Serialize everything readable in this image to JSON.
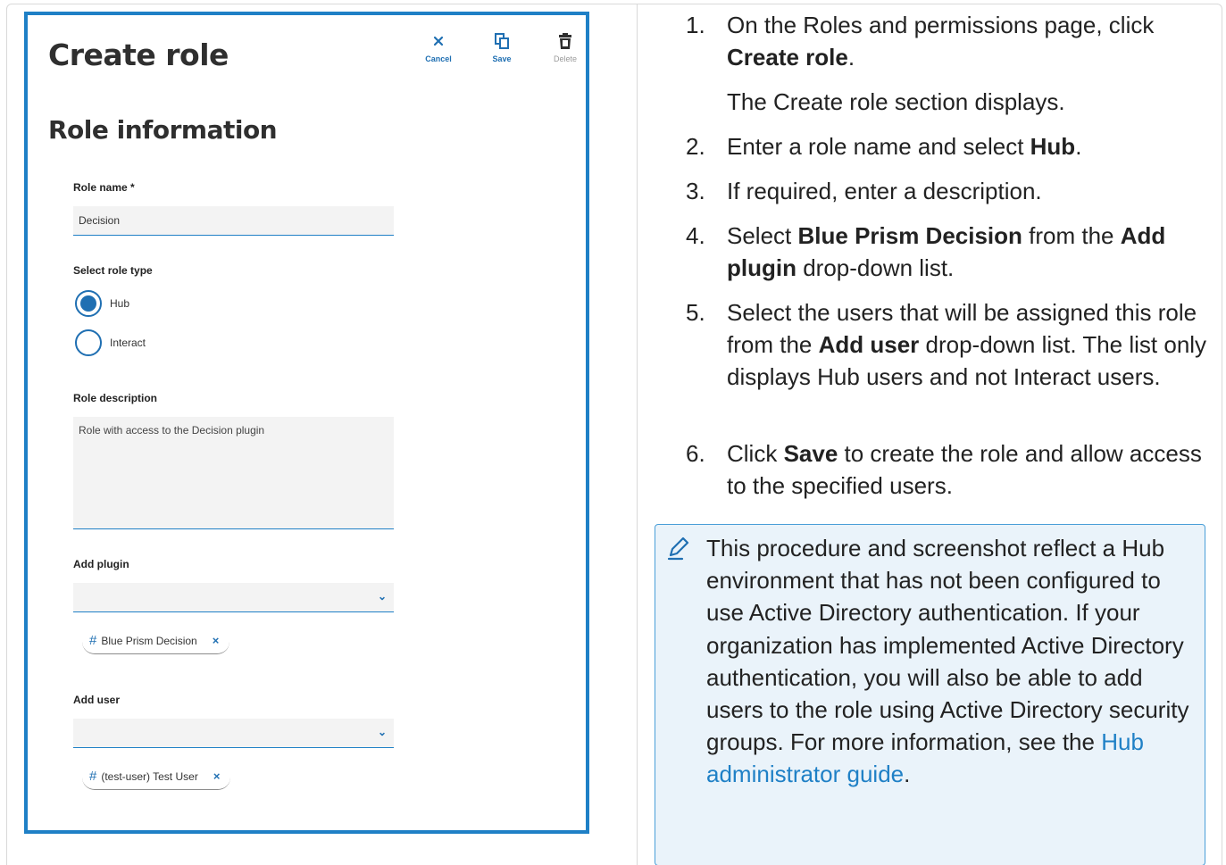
{
  "screenshot": {
    "title": "Create role",
    "toolbar": {
      "cancel": "Cancel",
      "save": "Save",
      "delete": "Delete"
    },
    "section_title": "Role information",
    "role_name": {
      "label": "Role name *",
      "value": "Decision"
    },
    "role_type": {
      "label": "Select role type",
      "options": [
        {
          "label": "Hub",
          "selected": true
        },
        {
          "label": "Interact",
          "selected": false
        }
      ]
    },
    "role_description": {
      "label": "Role description",
      "value": "Role with access to the Decision plugin"
    },
    "add_plugin": {
      "label": "Add plugin",
      "chip": "Blue Prism Decision"
    },
    "add_user": {
      "label": "Add user",
      "chip": "(test-user) Test User"
    }
  },
  "steps": [
    {
      "num": "1.",
      "pre": "On the Roles and permissions page, click ",
      "bold": "Create role",
      "post": ".",
      "sub": "The Create role section displays."
    },
    {
      "num": "2.",
      "pre": "Enter a role name and select ",
      "bold": "Hub",
      "post": "."
    },
    {
      "num": "3.",
      "pre": "If required, enter a description."
    },
    {
      "num": "4.",
      "pre": "Select ",
      "bold": "Blue Prism Decision",
      "mid": " from the ",
      "bold2": "Add plugin",
      "post": " drop-down list."
    },
    {
      "num": "5.",
      "pre": "Select the users that will be assigned this role from the ",
      "bold": "Add user",
      "post": " drop-down list. The list only displays Hub users and not Interact users."
    },
    {
      "num": "6.",
      "pre": "Click ",
      "bold": "Save",
      "post": " to create the role and allow access to the specified users."
    }
  ],
  "note": {
    "text": "This procedure and screenshot reflect a Hub environment that has not been configured to use Active Directory authentication. If your organization has implemented Active Directory authentication, you will also be able to add users to the role using Active Directory security groups. For more information, see the ",
    "link": "Hub administrator guide",
    "end": "."
  },
  "colors": {
    "accent": "#1f80c6",
    "note_bg": "#eaf3fa"
  },
  "icons": [
    "close-icon",
    "duplicate-icon",
    "trash-icon",
    "chevron-down-icon",
    "hash-icon",
    "pen-note-icon"
  ]
}
